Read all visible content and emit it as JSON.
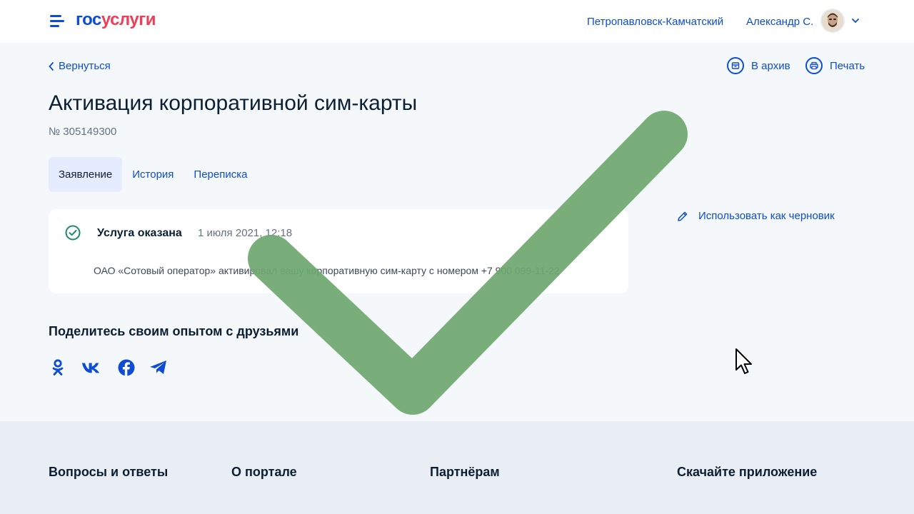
{
  "header": {
    "logo_part1": "гос",
    "logo_part2": "услуги",
    "city": "Петропавловск-Камчатский",
    "user_name": "Александр С."
  },
  "nav": {
    "back": "Вернуться",
    "archive": "В архив",
    "print": "Печать"
  },
  "page": {
    "title": "Активация корпоративной сим-карты",
    "number": "№ 305149300"
  },
  "tabs": [
    {
      "label": "Заявление",
      "active": true
    },
    {
      "label": "История",
      "active": false
    },
    {
      "label": "Переписка",
      "active": false
    }
  ],
  "status_card": {
    "status": "Услуга оказана",
    "date": "1 июля 2021, 12:18",
    "message": "ОАО «Сотовый оператор» активировал вашу корпоративную сим-карту с номером +7 900 099-11-22"
  },
  "side": {
    "draft": "Использовать как черновик"
  },
  "share": {
    "title": "Поделитесь своим опытом с друзьями",
    "icons": [
      "odnoklassniki-icon",
      "vk-icon",
      "facebook-icon",
      "telegram-icon"
    ]
  },
  "footer": {
    "faq": "Вопросы и ответы",
    "about": "О портале",
    "partners": "Партнёрам",
    "app": "Скачайте приложение"
  },
  "colors": {
    "brand_blue": "#0d4cd3",
    "brand_red": "#ee3f58",
    "success": "#1e8a6a",
    "checkmark_overlay": "#6ea76f"
  }
}
